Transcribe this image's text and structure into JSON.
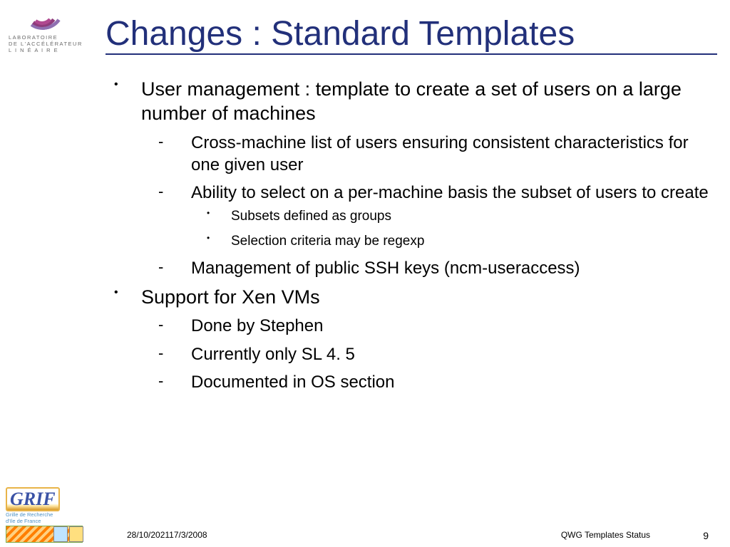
{
  "title": "Changes : Standard Templates",
  "top_logo": {
    "lab_line1": "LABORATOIRE",
    "lab_line2": "DE L'ACCÉLÉRATEUR",
    "lab_line3": "L I N É A I R E"
  },
  "bullets": {
    "b1": "User management : template to create a set of users on a large number of machines",
    "b1_sub1": "Cross-machine list of users ensuring consistent characteristics for one given user",
    "b1_sub2": "Ability to select on a per-machine basis the subset of users to create",
    "b1_sub2_a": "Subsets defined as groups",
    "b1_sub2_b": "Selection criteria may be regexp",
    "b1_sub3": "Management of public SSH keys (ncm-useraccess)",
    "b2": "Support for Xen VMs",
    "b2_sub1": "Done by Stephen",
    "b2_sub2": "Currently only SL 4. 5",
    "b2_sub3": "Documented in OS section"
  },
  "footer": {
    "grif": "GRIF",
    "grif_sub1": "Grille de Recherche",
    "grif_sub2": "d'Ile de France",
    "date": "28/10/202117/3/2008",
    "status": "QWG Templates Status",
    "page": "9"
  }
}
